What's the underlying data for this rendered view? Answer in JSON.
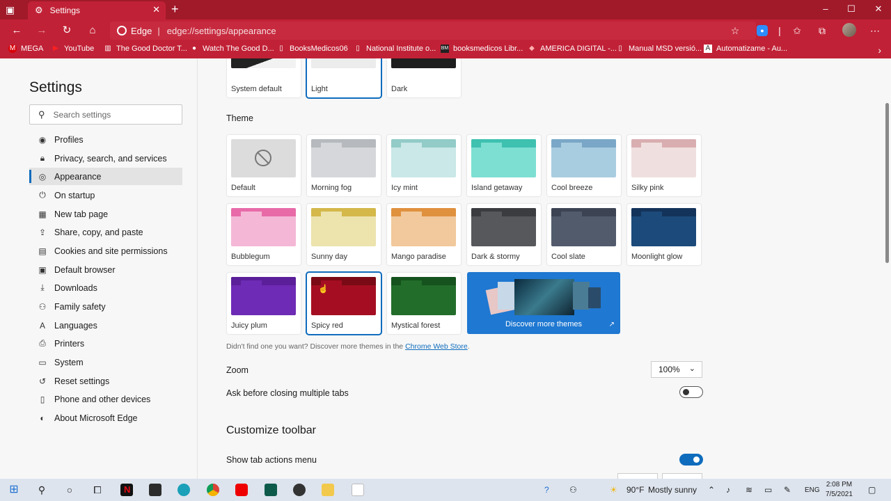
{
  "browser": {
    "tab_title": "Settings",
    "site_label": "Edge",
    "url": "edge://settings/appearance",
    "accent_color": "#c12136"
  },
  "bookmarks": [
    {
      "label": "MEGA",
      "icon": "mega-icon"
    },
    {
      "label": "YouTube",
      "icon": "youtube-icon"
    },
    {
      "label": "The Good Doctor T...",
      "icon": "bookmark-icon"
    },
    {
      "label": "Watch The Good D...",
      "icon": "abc-icon"
    },
    {
      "label": "BooksMedicos06",
      "icon": "page-icon"
    },
    {
      "label": "National Institute o...",
      "icon": "page-icon"
    },
    {
      "label": "booksmedicos Libr...",
      "icon": "bm-icon"
    },
    {
      "label": "AMERICA DIGITAL -...",
      "icon": "america-icon"
    },
    {
      "label": "Manual MSD versió...",
      "icon": "page-icon"
    },
    {
      "label": "Automatizame - Au...",
      "icon": "automatizame-icon"
    }
  ],
  "sidebar": {
    "title": "Settings",
    "search_placeholder": "Search settings",
    "items": [
      {
        "label": "Profiles",
        "icon": "profile-icon"
      },
      {
        "label": "Privacy, search, and services",
        "icon": "lock-icon"
      },
      {
        "label": "Appearance",
        "icon": "palette-icon",
        "active": true
      },
      {
        "label": "On startup",
        "icon": "power-icon"
      },
      {
        "label": "New tab page",
        "icon": "newtab-icon"
      },
      {
        "label": "Share, copy, and paste",
        "icon": "share-icon"
      },
      {
        "label": "Cookies and site permissions",
        "icon": "cookie-icon"
      },
      {
        "label": "Default browser",
        "icon": "browser-icon"
      },
      {
        "label": "Downloads",
        "icon": "download-icon"
      },
      {
        "label": "Family safety",
        "icon": "family-icon"
      },
      {
        "label": "Languages",
        "icon": "language-icon"
      },
      {
        "label": "Printers",
        "icon": "printer-icon"
      },
      {
        "label": "System",
        "icon": "laptop-icon"
      },
      {
        "label": "Reset settings",
        "icon": "reset-icon"
      },
      {
        "label": "Phone and other devices",
        "icon": "phone-icon"
      },
      {
        "label": "About Microsoft Edge",
        "icon": "edge-icon"
      }
    ]
  },
  "appearance": {
    "modes": [
      {
        "label": "System default"
      },
      {
        "label": "Light",
        "selected": true
      },
      {
        "label": "Dark"
      }
    ],
    "theme_heading": "Theme",
    "themes": [
      {
        "label": "Default",
        "bar": "#cfcfcf",
        "body": "#dcdcdc"
      },
      {
        "label": "Morning fog",
        "bar": "#b6b9bd",
        "body": "#d5d7da"
      },
      {
        "label": "Icy mint",
        "bar": "#92cbc7",
        "body": "#c9e8e7"
      },
      {
        "label": "Island getaway",
        "bar": "#3fc1b0",
        "body": "#7ddfd2"
      },
      {
        "label": "Cool breeze",
        "bar": "#7aa7c7",
        "body": "#a9cde0"
      },
      {
        "label": "Silky pink",
        "bar": "#d9aeb0",
        "body": "#efe0df"
      },
      {
        "label": "Bubblegum",
        "bar": "#e86ba8",
        "body": "#f4b8d6"
      },
      {
        "label": "Sunny day",
        "bar": "#d4b84a",
        "body": "#ece3ad"
      },
      {
        "label": "Mango paradise",
        "bar": "#e0913e",
        "body": "#f1c99c"
      },
      {
        "label": "Dark & stormy",
        "bar": "#3a3c40",
        "body": "#56585c"
      },
      {
        "label": "Cool slate",
        "bar": "#3c4454",
        "body": "#515b6c"
      },
      {
        "label": "Moonlight glow",
        "bar": "#14335a",
        "body": "#1c4a7a"
      },
      {
        "label": "Juicy plum",
        "bar": "#5b1f9a",
        "body": "#6e2bb5"
      },
      {
        "label": "Spicy red",
        "bar": "#7a0a16",
        "body": "#a50e22",
        "selected": true
      },
      {
        "label": "Mystical forest",
        "bar": "#15521d",
        "body": "#226d2a"
      }
    ],
    "discover_label": "Discover more themes",
    "hint_text": "Didn't find one you want? Discover more themes in the",
    "hint_link": "Chrome Web Store",
    "hint_end": ".",
    "zoom_label": "Zoom",
    "zoom_value": "100%",
    "ask_close_label": "Ask before closing multiple tabs",
    "ask_close_on": false,
    "customize_title": "Customize toolbar",
    "tab_actions_label": "Show tab actions menu",
    "tab_actions_on": true
  },
  "taskbar": {
    "weather": "90°F",
    "weather_desc": "Mostly sunny",
    "language": "ENG",
    "time": "2:08 PM",
    "date": "7/5/2021"
  }
}
